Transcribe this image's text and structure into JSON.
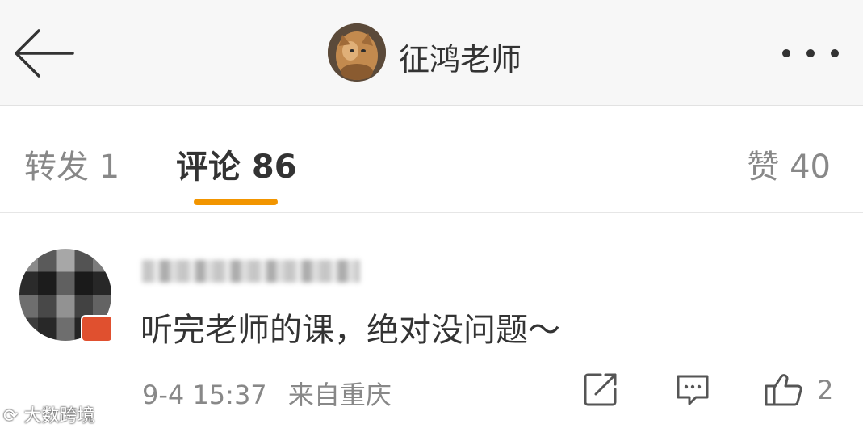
{
  "header": {
    "title": "征鸿老师"
  },
  "tabs": [
    {
      "label": "转发 1"
    },
    {
      "label": "评论 86"
    },
    {
      "label": "赞 40"
    }
  ],
  "comment": {
    "text": "听完老师的课，绝对没问题～",
    "date": "9-4 15:37",
    "source": "来自重庆",
    "like_count": "2"
  },
  "watermark": {
    "text": "大数跨境"
  },
  "colors": {
    "accent": "#f29500",
    "text_primary": "#333333",
    "text_secondary": "#888888"
  }
}
